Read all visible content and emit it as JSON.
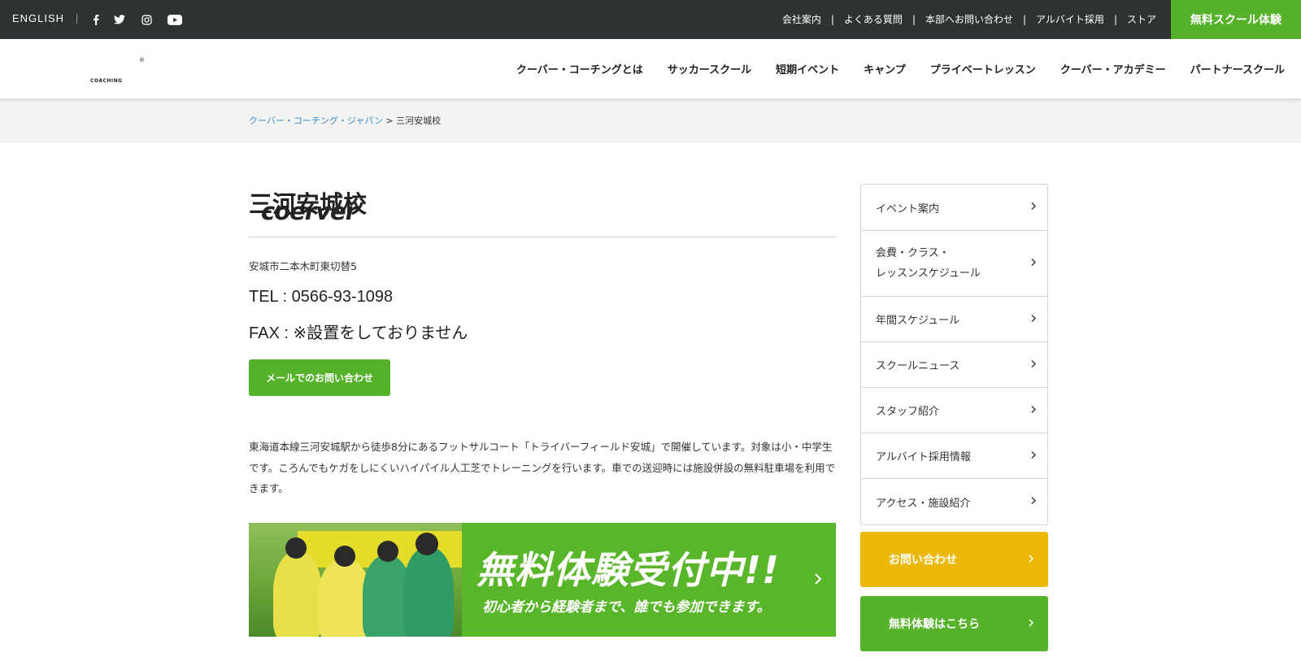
{
  "topbar": {
    "language": "ENGLISH",
    "social": [
      {
        "icon": "facebook-icon"
      },
      {
        "icon": "twitter-icon"
      },
      {
        "icon": "instagram-icon"
      },
      {
        "icon": "youtube-icon"
      }
    ],
    "links": [
      "会社案内",
      "よくある質問",
      "本部へお問い合わせ",
      "アルバイト採用",
      "ストア"
    ],
    "separator": "|",
    "cta": "無料スクール体験"
  },
  "header": {
    "logo": {
      "wordmark": "coerver",
      "sub": "COACHING",
      "reg": "®"
    },
    "nav": [
      "クーバー・コーチングとは",
      "サッカースクール",
      "短期イベント",
      "キャンプ",
      "プライベートレッスン",
      "クーバー・アカデミー",
      "パートナースクール"
    ]
  },
  "breadcrumb": {
    "home": "クーバー・コーチング・ジャパン",
    "separator": ">",
    "current": "三河安城校"
  },
  "school": {
    "title": "三河安城校",
    "address": "安城市二本木町東切替5",
    "tel": "TEL : 0566-93-1098",
    "fax": "FAX : ※設置をしておりません",
    "mail_button": "メールでのお問い合わせ",
    "description": "東海道本線三河安城駅から徒歩8分にあるフットサルコート「トライバーフィールド安城」で開催しています。対象は小・中学生です。ころんでもケガをしにくいハイパイル人工芝でトレーニングを行います。車での送迎時には施設併設の無料駐車場を利用できます。"
  },
  "banner": {
    "headline": "無料体験受付中!!",
    "subline": "初心者から経験者まで、誰でも参加できます。"
  },
  "sidebar": {
    "items": [
      {
        "label": "イベント案内"
      },
      {
        "label": "会費・クラス・",
        "label2": "レッスンスケジュール"
      },
      {
        "label": "年間スケジュール"
      },
      {
        "label": "スクールニュース"
      },
      {
        "label": "スタッフ紹介"
      },
      {
        "label": "アルバイト採用情報"
      },
      {
        "label": "アクセス・施設紹介"
      }
    ],
    "contact_button": "お問い合わせ",
    "trial_button": "無料体験はこちら"
  },
  "colors": {
    "topbar": "#2e3233",
    "green": "#57b22b",
    "yellow": "#ecb90b",
    "link": "#3a8cc9"
  }
}
